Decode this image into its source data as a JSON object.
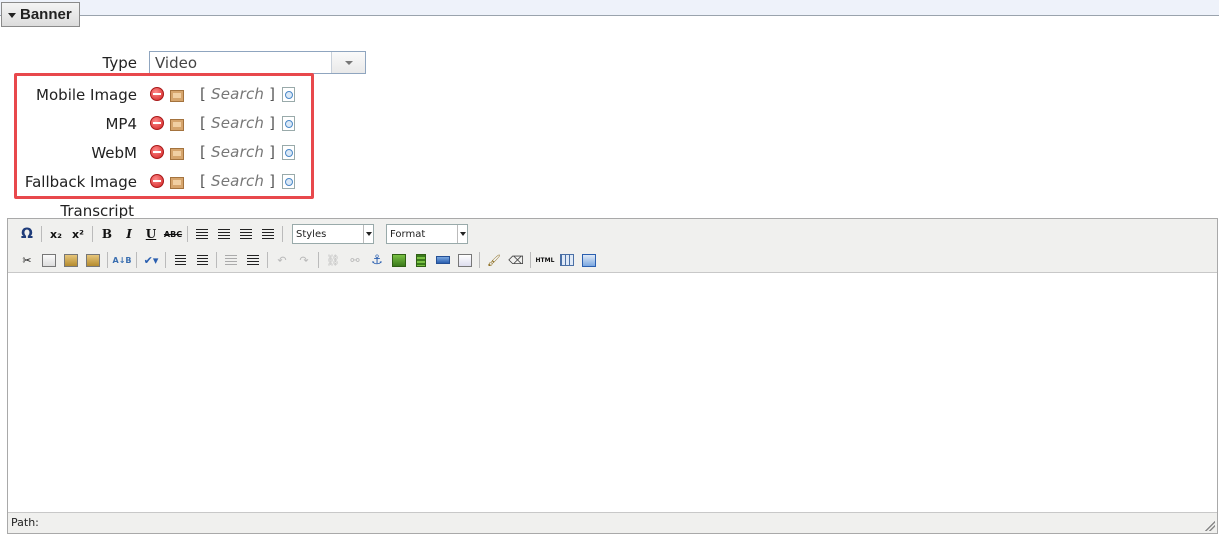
{
  "section": {
    "title": "Banner"
  },
  "type_field": {
    "label": "Type",
    "value": "Video"
  },
  "media_rows": [
    {
      "label": "Mobile Image",
      "search": "Search"
    },
    {
      "label": "MP4",
      "search": "Search"
    },
    {
      "label": "WebM",
      "search": "Search"
    },
    {
      "label": "Fallback Image",
      "search": "Search"
    }
  ],
  "bracket_open": "[",
  "bracket_close": "]",
  "transcript": {
    "label": "Transcript",
    "styles_select": "Styles",
    "format_select": "Format",
    "path_label": "Path:"
  },
  "colors": {
    "highlight": "#e8484c",
    "remove": "#d02020"
  }
}
